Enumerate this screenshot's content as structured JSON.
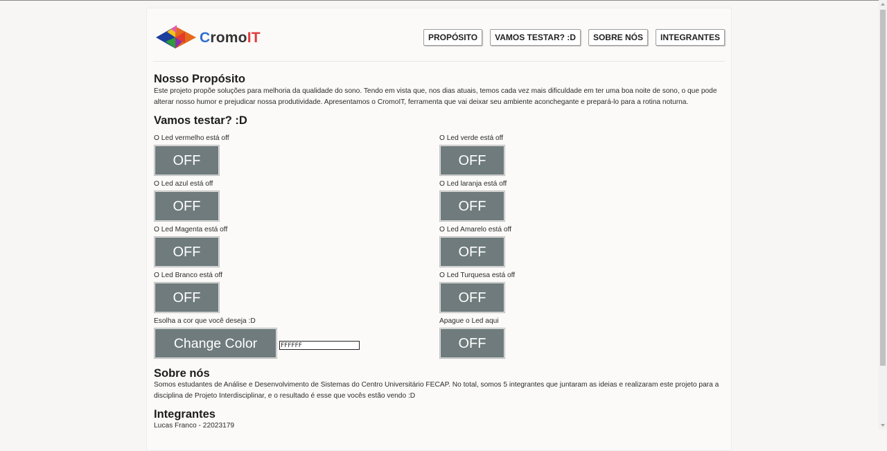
{
  "brand": {
    "part1": "C",
    "part2": "romo",
    "part3": "IT"
  },
  "nav": {
    "proposito": "PROPÓSITO",
    "vamos_testar": "VAMOS TESTAR? :D",
    "sobre_nos": "SOBRE NÓS",
    "integrantes": "INTEGRANTES"
  },
  "proposito": {
    "title": "Nosso Propósito",
    "line1": "Este projeto propõe soluções para melhoria da qualidade do sono. Tendo em vista que, nos dias atuais, temos cada vez mais dificuldade em ter uma boa noite de sono, o que pode",
    "line2": "alterar nosso humor e prejudicar nossa produtividade. Apresentamos o CromoIT, ferramenta que vai deixar seu ambiente aconchegante e prepará-lo para a rotina noturna."
  },
  "testar": {
    "title": "Vamos testar? :D",
    "leds": [
      {
        "label": "O Led vermelho está off",
        "button": "OFF"
      },
      {
        "label": "O Led verde está off",
        "button": "OFF"
      },
      {
        "label": "O Led azul está off",
        "button": "OFF"
      },
      {
        "label": "O Led laranja está off",
        "button": "OFF"
      },
      {
        "label": "O Led Magenta está off",
        "button": "OFF"
      },
      {
        "label": "O Led Amarelo está off",
        "button": "OFF"
      },
      {
        "label": "O Led Branco está off",
        "button": "OFF"
      },
      {
        "label": "O Led Turquesa está off",
        "button": "OFF"
      }
    ],
    "color_label": "Esolha a cor que você deseja :D",
    "change_button": "Change Color",
    "color_value": "FFFFFF",
    "apague_label": "Apague o Led aqui",
    "apague_button": "OFF"
  },
  "sobre": {
    "title": "Sobre nós",
    "line1": "Somos estudantes de Análise e Desenvolvimento de Sistemas do Centro Universitário FECAP. No total, somos 5 integrantes que juntaram as ideias e realizaram este projeto para a",
    "line2": "disciplina de Projeto Interdisciplinar, e o resultado é esse que vocês estão vendo :D"
  },
  "integrantes": {
    "title": "Integrantes",
    "members": [
      "Lucas Franco - 22023179"
    ]
  },
  "colors": {
    "button_gray": "#6f7b7c",
    "brand_blue": "#2e6fd1",
    "brand_red": "#e23a3a"
  },
  "icons": {
    "logo": "cromoit-logo"
  }
}
